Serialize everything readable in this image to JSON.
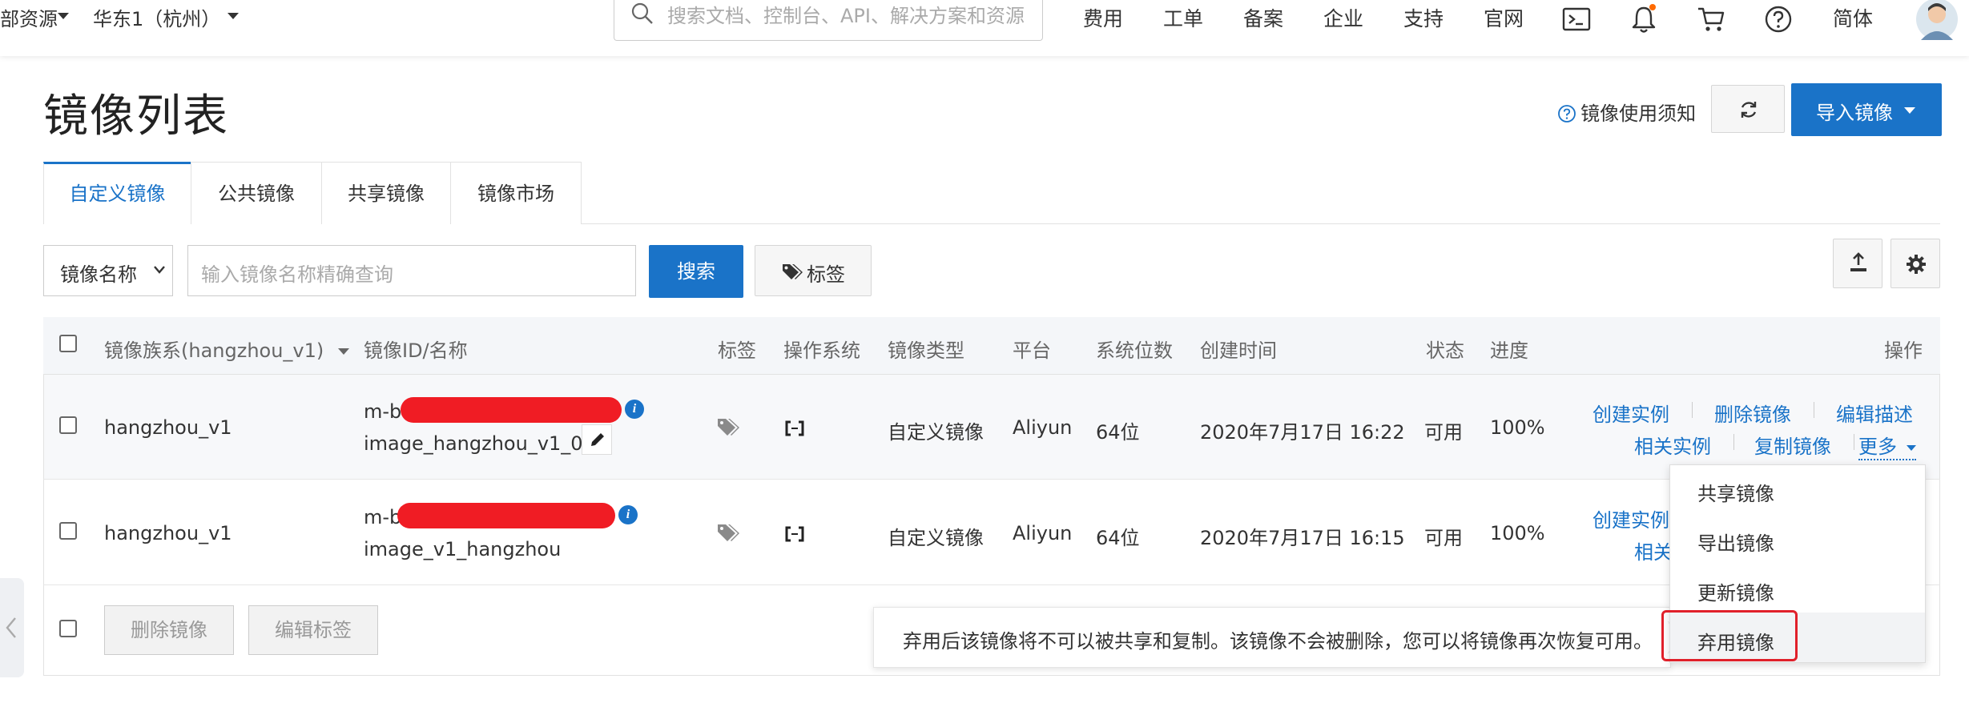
{
  "header": {
    "resource_label": "部资源",
    "region_label": "华东1（杭州）",
    "search_placeholder": "搜索文档、控制台、API、解决方案和资源",
    "nav": [
      "费用",
      "工单",
      "备案",
      "企业",
      "支持",
      "官网"
    ],
    "language": "简体"
  },
  "page": {
    "title": "镜像列表",
    "notice_link": "镜像使用须知",
    "import_button": "导入镜像"
  },
  "tabs": [
    "自定义镜像",
    "公共镜像",
    "共享镜像",
    "镜像市场"
  ],
  "filter": {
    "select_value": "镜像名称",
    "input_placeholder": "输入镜像名称精确查询",
    "search_button": "搜索",
    "tag_button": "标签"
  },
  "table": {
    "headers": [
      "镜像族系(hangzhou_v1)",
      "镜像ID/名称",
      "标签",
      "操作系统",
      "镜像类型",
      "平台",
      "系统位数",
      "创建时间",
      "状态",
      "进度",
      "操作"
    ],
    "rows": [
      {
        "family": "hangzhou_v1",
        "id_prefix": "m-b",
        "name": "image_hangzhou_v1_01",
        "type": "自定义镜像",
        "platform": "Aliyun",
        "bits": "64位",
        "created": "2020年7月17日 16:22",
        "status": "可用",
        "progress": "100%",
        "actions": [
          "创建实例",
          "删除镜像",
          "编辑描述",
          "相关实例",
          "复制镜像",
          "更多"
        ]
      },
      {
        "family": "hangzhou_v1",
        "id_prefix": "m-b",
        "name": "image_v1_hangzhou",
        "type": "自定义镜像",
        "platform": "Aliyun",
        "bits": "64位",
        "created": "2020年7月17日 16:15",
        "status": "可用",
        "progress": "100%",
        "actions": [
          "创建实例",
          "相关"
        ]
      }
    ]
  },
  "footer": {
    "delete_button": "删除镜像",
    "edit_tags_button": "编辑标签"
  },
  "dropdown": {
    "items": [
      "共享镜像",
      "导出镜像",
      "更新镜像",
      "弃用镜像"
    ],
    "highlighted": "弃用镜像"
  },
  "tooltip": {
    "text": "弃用后该镜像将不可以被共享和复制。该镜像不会被删除，您可以将镜像再次恢复可用。"
  },
  "colors": {
    "primary": "#1a73c8",
    "highlight_border": "#e0202a",
    "notification_dot": "#ff6a00",
    "redaction": "#f01c24"
  }
}
